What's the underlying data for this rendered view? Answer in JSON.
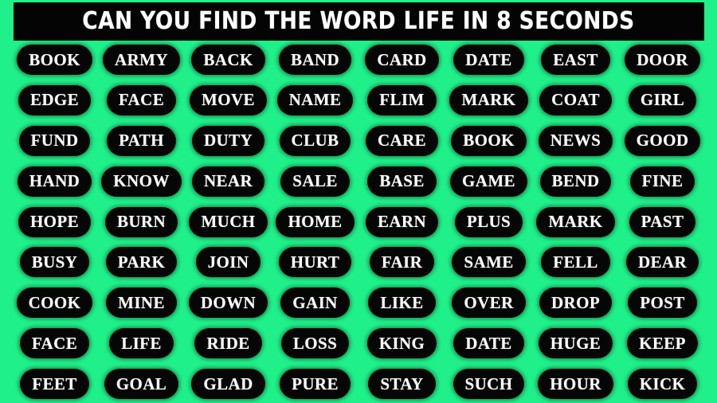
{
  "theme": {
    "background_color": "#1ff089",
    "pill_color": "#060606",
    "text_color": "#ffffff",
    "banner_color": "#040404"
  },
  "banner": {
    "title": "CAN YOU FIND THE WORD LIFE IN 8 SECONDS",
    "target_word": "LIFE",
    "time_limit_seconds": "8"
  },
  "grid": {
    "rows": 9,
    "columns": 8,
    "total_words": 72,
    "words": [
      [
        "BOOK",
        "ARMY",
        "BACK",
        "BAND",
        "CARD",
        "DATE",
        "EAST",
        "DOOR"
      ],
      [
        "EDGE",
        "FACE",
        "MOVE",
        "NAME",
        "FLIM",
        "MARK",
        "COAT",
        "GIRL"
      ],
      [
        "FUND",
        "PATH",
        "DUTY",
        "CLUB",
        "CARE",
        "BOOK",
        "NEWS",
        "GOOD"
      ],
      [
        "HAND",
        "KNOW",
        "NEAR",
        "SALE",
        "BASE",
        "GAME",
        "BEND",
        "FINE"
      ],
      [
        "HOPE",
        "BURN",
        "MUCH",
        "HOME",
        "EARN",
        "PLUS",
        "MARK",
        "PAST"
      ],
      [
        "BUSY",
        "PARK",
        "JOIN",
        "HURT",
        "FAIR",
        "SAME",
        "FELL",
        "DEAR"
      ],
      [
        "COOK",
        "MINE",
        "DOWN",
        "GAIN",
        "LIKE",
        "OVER",
        "DROP",
        "POST"
      ],
      [
        "FACE",
        "LIFE",
        "RIDE",
        "LOSS",
        "KING",
        "DATE",
        "HUGE",
        "KEEP"
      ],
      [
        "FEET",
        "GOAL",
        "GLAD",
        "PURE",
        "STAY",
        "SUCH",
        "HOUR",
        "KICK"
      ]
    ]
  }
}
